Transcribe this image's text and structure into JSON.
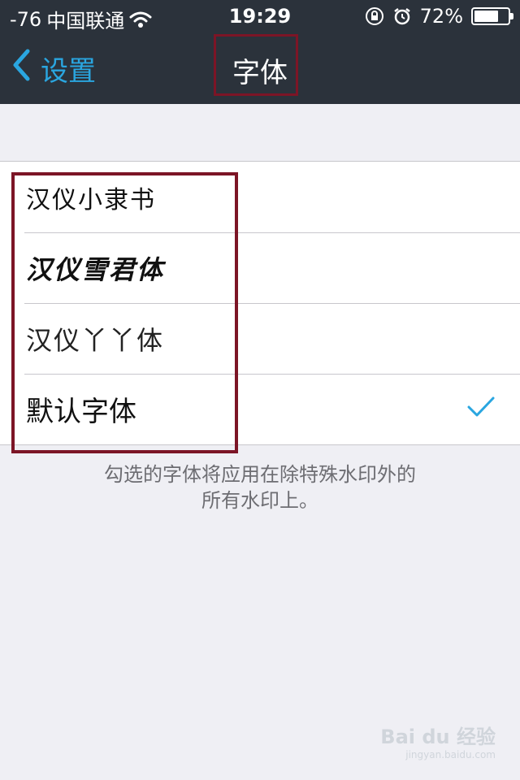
{
  "status": {
    "signal": "-76",
    "carrier": "中国联通",
    "time": "19:29",
    "battery": "72%",
    "battery_level": 0.72
  },
  "nav": {
    "back_label": "设置",
    "title": "字体"
  },
  "fonts": [
    {
      "label": "汉仪小隶书",
      "selected": false
    },
    {
      "label": "汉仪雪君体",
      "selected": false
    },
    {
      "label": "汉仪丫丫体",
      "selected": false
    },
    {
      "label": "默认字体",
      "selected": true
    }
  ],
  "footer": {
    "line1": "勾选的字体将应用在除特殊水印外的",
    "line2": "所有水印上。"
  },
  "watermark": {
    "logo": "Bai du 经验",
    "url": "jingyan.baidu.com"
  },
  "colors": {
    "accent": "#2aa6e0",
    "bar": "#2b323b",
    "highlight": "#7c1526"
  }
}
